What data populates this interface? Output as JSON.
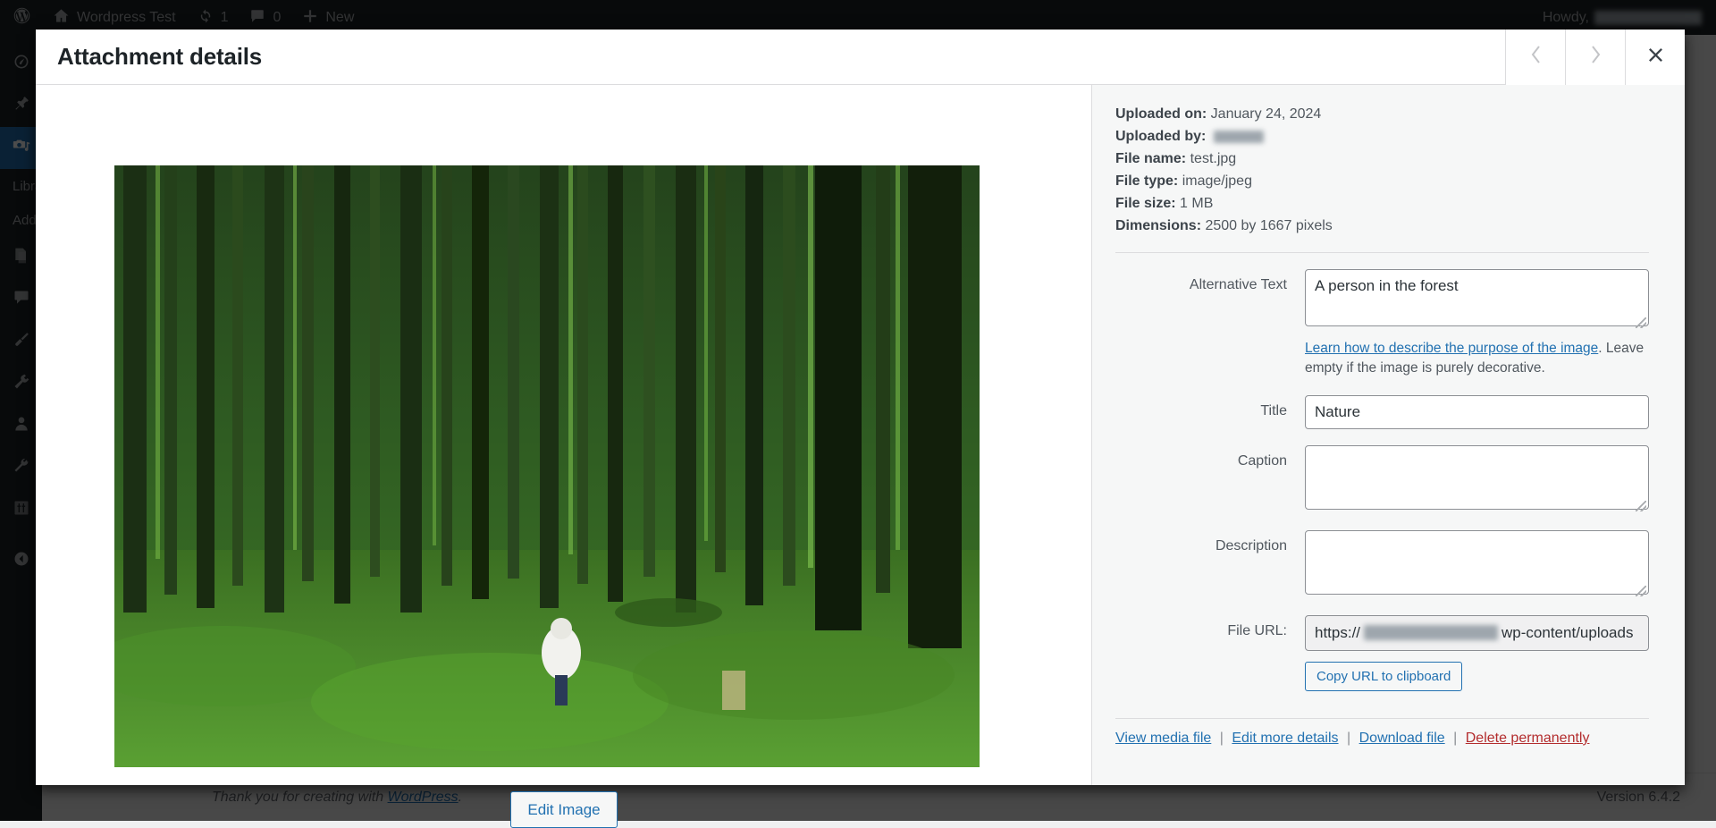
{
  "adminbar": {
    "logo_icon": "wordpress-logo-icon",
    "site": {
      "icon": "home-icon",
      "label": "Wordpress Test"
    },
    "updates": {
      "icon": "updates-icon",
      "count": "1"
    },
    "comments": {
      "icon": "comment-bubble-icon",
      "count": "0"
    },
    "new": {
      "icon": "plus-icon",
      "label": "New"
    },
    "account": {
      "greeting": "Howdy,"
    }
  },
  "sidebar": {
    "items": [
      {
        "icon": "dashboard-gauge-icon",
        "name": "dashboard"
      },
      {
        "icon": "pin-icon",
        "name": "posts"
      },
      {
        "icon": "media-camera-music-icon",
        "name": "media",
        "current": true
      },
      {
        "icon": "pages-icon",
        "name": "pages"
      },
      {
        "icon": "comment-bubble-icon",
        "name": "comments"
      },
      {
        "icon": "paintbrush-icon",
        "name": "appearance"
      },
      {
        "icon": "plug-icon",
        "name": "plugins"
      },
      {
        "icon": "user-icon",
        "name": "users"
      },
      {
        "icon": "wrench-icon",
        "name": "tools"
      },
      {
        "icon": "sliders-icon",
        "name": "settings"
      },
      {
        "icon": "collapse-arrow-icon",
        "name": "collapse-menu"
      }
    ],
    "submenu": [
      {
        "label": "Library"
      },
      {
        "label": "Add New Media File"
      }
    ]
  },
  "modal": {
    "title": "Attachment details",
    "prev_icon": "chevron-left-icon",
    "next_icon": "chevron-right-icon",
    "close_icon": "close-x-icon",
    "edit_image_label": "Edit Image"
  },
  "attachment": {
    "meta": [
      {
        "label": "Uploaded on:",
        "value": "January 24, 2024",
        "redacted": false
      },
      {
        "label": "Uploaded by:",
        "value": "",
        "redacted": true
      },
      {
        "label": "File name:",
        "value": "test.jpg",
        "redacted": false
      },
      {
        "label": "File type:",
        "value": "image/jpeg",
        "redacted": false
      },
      {
        "label": "File size:",
        "value": "1 MB",
        "redacted": false
      },
      {
        "label": "Dimensions:",
        "value": "2500 by 1667 pixels",
        "redacted": false
      }
    ],
    "fields": {
      "alt_text": {
        "label": "Alternative Text",
        "value": "A person in the forest"
      },
      "alt_help_link": "Learn how to describe the purpose of the image",
      "alt_help_rest": ". Leave empty if the image is purely decorative.",
      "title": {
        "label": "Title",
        "value": "Nature"
      },
      "caption": {
        "label": "Caption",
        "value": ""
      },
      "description": {
        "label": "Description",
        "value": ""
      },
      "file_url": {
        "label": "File URL:",
        "prefix": "https://",
        "suffix": "wp-content/uploads",
        "copy_label": "Copy URL to clipboard"
      }
    },
    "actions": {
      "view": "View media file",
      "edit_more": "Edit more details",
      "download": "Download file",
      "delete": "Delete permanently",
      "separator": "|"
    }
  },
  "footer": {
    "thanks_prefix": "Thank you for creating with ",
    "thanks_link": "WordPress",
    "thanks_suffix": ".",
    "version": "Version 6.4.2"
  },
  "colors": {
    "admin_bg": "#1d2327",
    "accent": "#2271b1",
    "danger": "#b32d2e",
    "panel_bg": "#f6f7f7"
  }
}
